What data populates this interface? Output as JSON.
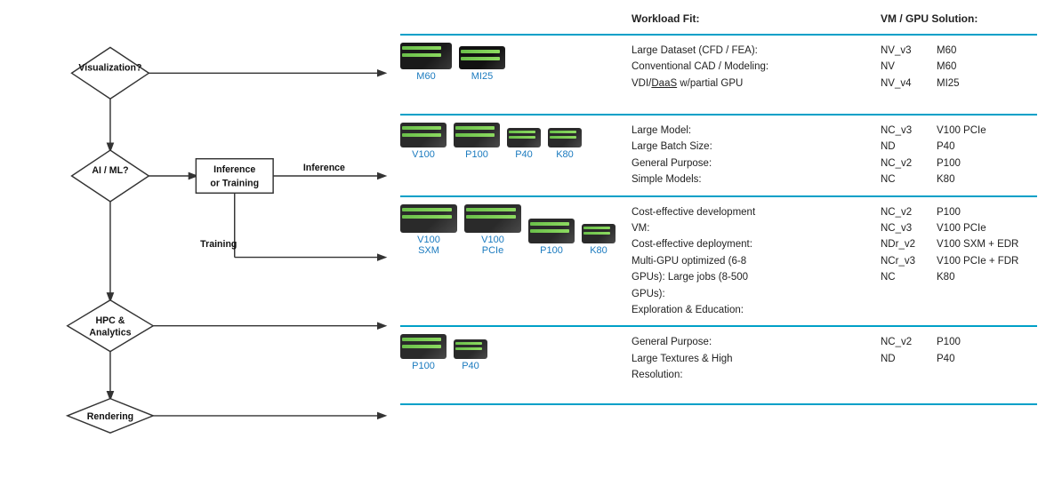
{
  "header": {
    "workload_label": "Workload Fit:",
    "vm_label": "VM / GPU Solution:"
  },
  "sections": [
    {
      "id": "visualization",
      "gpus": [
        {
          "label": "M60",
          "style": "m60"
        },
        {
          "label": "MI25",
          "style": "mi25"
        }
      ],
      "workload_lines": [
        {
          "key": "Large Dataset (CFD / FEA):",
          "val": ""
        },
        {
          "key": "Conventional CAD / Modeling:",
          "val": ""
        },
        {
          "key": "VDI/DaaS w/partial GPU",
          "val": ""
        }
      ],
      "vm_lines": [
        {
          "key": "NV_v3",
          "val": "M60"
        },
        {
          "key": "NV",
          "val": "M60"
        },
        {
          "key": "NV_v4",
          "val": "MI25"
        }
      ]
    },
    {
      "id": "ai-inference",
      "gpus": [
        {
          "label": "V100",
          "style": ""
        },
        {
          "label": "P100",
          "style": ""
        },
        {
          "label": "P40",
          "style": "tall"
        },
        {
          "label": "K80",
          "style": "tall"
        }
      ],
      "workload_lines": [
        {
          "key": "Large Model:",
          "val": ""
        },
        {
          "key": "Large Batch Size:",
          "val": ""
        },
        {
          "key": "General Purpose:",
          "val": ""
        },
        {
          "key": "Simple Models:",
          "val": ""
        }
      ],
      "vm_lines": [
        {
          "key": "NC_v3",
          "val": "V100 PCIe"
        },
        {
          "key": "ND",
          "val": "P40"
        },
        {
          "key": "NC_v2",
          "val": "P100"
        },
        {
          "key": "NC",
          "val": "K80"
        }
      ]
    },
    {
      "id": "ai-training",
      "gpus": [
        {
          "label": "V100\nSXM",
          "style": "wide",
          "multiline": true,
          "line1": "V100",
          "line2": "SXM"
        },
        {
          "label": "V100\nPCIe",
          "style": "wide",
          "multiline": true,
          "line1": "V100",
          "line2": "PCIe"
        },
        {
          "label": "P100",
          "style": ""
        },
        {
          "label": "K80",
          "style": "tall"
        }
      ],
      "workload_lines": [
        {
          "key": "Cost-effective development",
          "val": ""
        },
        {
          "key": "VM:",
          "val": ""
        },
        {
          "key": "Cost-effective deployment:",
          "val": ""
        },
        {
          "key": "Multi-GPU optimized (6-8",
          "val": ""
        },
        {
          "key": "GPUs): Large jobs (8-500",
          "val": ""
        },
        {
          "key": "GPUs):",
          "val": ""
        },
        {
          "key": "Exploration & Education:",
          "val": ""
        }
      ],
      "vm_lines": [
        {
          "key": "NC_v2",
          "val": "P100"
        },
        {
          "key": "NC_v3",
          "val": "V100 PCIe"
        },
        {
          "key": "NDr_v2",
          "val": "V100 SXM + EDR"
        },
        {
          "key": "NCr_v3",
          "val": "V100 PCIe + FDR"
        },
        {
          "key": "NC",
          "val": "K80"
        }
      ]
    },
    {
      "id": "rendering",
      "gpus": [
        {
          "label": "P100",
          "style": ""
        },
        {
          "label": "P40",
          "style": "tall"
        }
      ],
      "workload_lines": [
        {
          "key": "General Purpose:",
          "val": ""
        },
        {
          "key": "Large Textures & High",
          "val": ""
        },
        {
          "key": "Resolution:",
          "val": ""
        }
      ],
      "vm_lines": [
        {
          "key": "NC_v2",
          "val": "P100"
        },
        {
          "key": "ND",
          "val": "P40"
        }
      ]
    }
  ],
  "flow": {
    "nodes": [
      {
        "id": "visualization",
        "label": "Visualization?",
        "type": "diamond"
      },
      {
        "id": "ai-ml",
        "label": "AI / ML?",
        "type": "diamond"
      },
      {
        "id": "inference-training",
        "label": "Inference\nor Training",
        "type": "box"
      },
      {
        "id": "inference-label",
        "label": "Inference",
        "type": "label"
      },
      {
        "id": "training-label",
        "label": "Training",
        "type": "label"
      },
      {
        "id": "hpc-analytics",
        "label": "HPC &\nAnalytics",
        "type": "diamond"
      },
      {
        "id": "rendering",
        "label": "Rendering",
        "type": "diamond"
      }
    ]
  }
}
